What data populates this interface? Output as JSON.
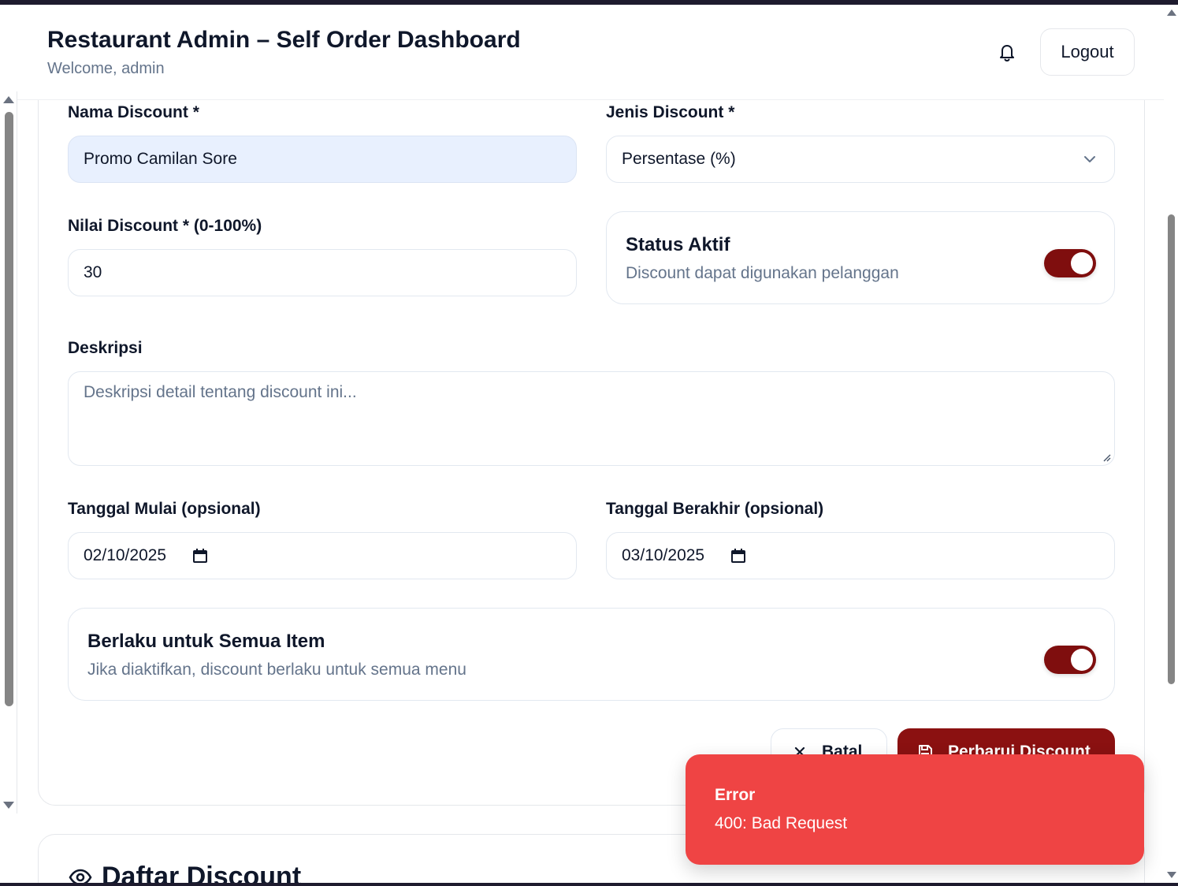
{
  "header": {
    "title": "Restaurant Admin – Self Order Dashboard",
    "welcome": "Welcome, admin",
    "logout_label": "Logout"
  },
  "form": {
    "name_label": "Nama Discount *",
    "name_value": "Promo Camilan Sore",
    "type_label": "Jenis Discount *",
    "type_value": "Persentase (%)",
    "value_label": "Nilai Discount * (0-100%)",
    "value_value": "30",
    "status": {
      "title": "Status Aktif",
      "description": "Discount dapat digunakan pelanggan",
      "enabled": true
    },
    "description_label": "Deskripsi",
    "description_placeholder": "Deskripsi detail tentang discount ini...",
    "start_label": "Tanggal Mulai (opsional)",
    "start_value": "02/10/2025",
    "end_label": "Tanggal Berakhir (opsional)",
    "end_value": "03/10/2025",
    "all_items": {
      "title": "Berlaku untuk Semua Item",
      "description": "Jika diaktifkan, discount berlaku untuk semua menu",
      "enabled": true
    },
    "cancel_label": "Batal",
    "submit_label": "Perbarui Discount"
  },
  "list": {
    "title": "Daftar Discount"
  },
  "toast": {
    "title": "Error",
    "message": "400: Bad Request"
  },
  "colors": {
    "accent": "#8b1111",
    "toggle": "#7f0e0e",
    "error": "#ef4444",
    "muted_text": "#64748b"
  },
  "icons": [
    "bell-icon",
    "chevron-down-icon",
    "calendar-icon",
    "close-icon",
    "save-icon",
    "eye-icon"
  ]
}
